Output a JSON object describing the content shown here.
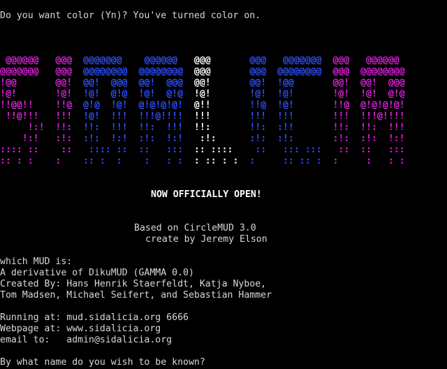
{
  "prompt_color": "Do you want color (Yn)? You've turned color on.",
  "banner": {
    "rows": [
      [
        {
          "t": " @@@@@@   ",
          "c": "#e020e0"
        },
        {
          "t": "@@@  ",
          "c": "#e020e0"
        },
        {
          "t": "@@@@@@@    ",
          "c": "#3050ff"
        },
        {
          "t": "@@@@@@   ",
          "c": "#3050ff"
        },
        {
          "t": "@@@       ",
          "c": "#ffffff"
        },
        {
          "t": "@@@   ",
          "c": "#3050ff"
        },
        {
          "t": "@@@@@@@  ",
          "c": "#3050ff"
        },
        {
          "t": "@@@   ",
          "c": "#e020e0"
        },
        {
          "t": "@@@@@@",
          "c": "#e020e0"
        }
      ],
      [
        {
          "t": "@@@@@@@   ",
          "c": "#e020e0"
        },
        {
          "t": "@@@  ",
          "c": "#e020e0"
        },
        {
          "t": "@@@@@@@@  ",
          "c": "#3050ff"
        },
        {
          "t": "@@@@@@@@  ",
          "c": "#3050ff"
        },
        {
          "t": "@@@       ",
          "c": "#ffffff"
        },
        {
          "t": "@@@  ",
          "c": "#3050ff"
        },
        {
          "t": "@@@@@@@@  ",
          "c": "#3050ff"
        },
        {
          "t": "@@@  ",
          "c": "#e020e0"
        },
        {
          "t": "@@@@@@@@",
          "c": "#e020e0"
        }
      ],
      [
        {
          "t": "!@@       ",
          "c": "#e020e0"
        },
        {
          "t": "@@!  ",
          "c": "#e020e0"
        },
        {
          "t": "@@!  @@@  ",
          "c": "#3050ff"
        },
        {
          "t": "@@!  @@@  ",
          "c": "#3050ff"
        },
        {
          "t": "@@!       ",
          "c": "#ffffff"
        },
        {
          "t": "@@!  ",
          "c": "#3050ff"
        },
        {
          "t": "!@@       ",
          "c": "#3050ff"
        },
        {
          "t": "@@!  ",
          "c": "#e020e0"
        },
        {
          "t": "@@!  @@@",
          "c": "#e020e0"
        }
      ],
      [
        {
          "t": "!@!       ",
          "c": "#e020e0"
        },
        {
          "t": "!@!  ",
          "c": "#e020e0"
        },
        {
          "t": "!@!  @!@  ",
          "c": "#3050ff"
        },
        {
          "t": "!@!  @!@  ",
          "c": "#3050ff"
        },
        {
          "t": "!@!       ",
          "c": "#ffffff"
        },
        {
          "t": "!@!  ",
          "c": "#3050ff"
        },
        {
          "t": "!@!       ",
          "c": "#3050ff"
        },
        {
          "t": "!@!  ",
          "c": "#e020e0"
        },
        {
          "t": "!@!  @!@",
          "c": "#e020e0"
        }
      ],
      [
        {
          "t": "!!@@!!    ",
          "c": "#e020e0"
        },
        {
          "t": "!!@  ",
          "c": "#e020e0"
        },
        {
          "t": "@!@  !@!  ",
          "c": "#3050ff"
        },
        {
          "t": "@!@!@!@!  ",
          "c": "#3050ff"
        },
        {
          "t": "@!!       ",
          "c": "#ffffff"
        },
        {
          "t": "!!@  ",
          "c": "#3050ff"
        },
        {
          "t": "!@!       ",
          "c": "#3050ff"
        },
        {
          "t": "!!@  ",
          "c": "#e020e0"
        },
        {
          "t": "@!@!@!@!",
          "c": "#e020e0"
        }
      ],
      [
        {
          "t": " !!@!!!   ",
          "c": "#e020e0"
        },
        {
          "t": "!!!  ",
          "c": "#e020e0"
        },
        {
          "t": "!@!  !!!  ",
          "c": "#3050ff"
        },
        {
          "t": "!!!@!!!!  ",
          "c": "#3050ff"
        },
        {
          "t": "!!!       ",
          "c": "#ffffff"
        },
        {
          "t": "!!!  ",
          "c": "#3050ff"
        },
        {
          "t": "!!!       ",
          "c": "#3050ff"
        },
        {
          "t": "!!!  ",
          "c": "#e020e0"
        },
        {
          "t": "!!!@!!!!",
          "c": "#e020e0"
        }
      ],
      [
        {
          "t": "     !:!  ",
          "c": "#e020e0"
        },
        {
          "t": "!!:  ",
          "c": "#e020e0"
        },
        {
          "t": "!!:  !!!  ",
          "c": "#3050ff"
        },
        {
          "t": "!!:  !!!  ",
          "c": "#3050ff"
        },
        {
          "t": "!!:       ",
          "c": "#ffffff"
        },
        {
          "t": "!!:  ",
          "c": "#3050ff"
        },
        {
          "t": ":!!       ",
          "c": "#3050ff"
        },
        {
          "t": "!!:  ",
          "c": "#e020e0"
        },
        {
          "t": "!!:  !!!",
          "c": "#e020e0"
        }
      ],
      [
        {
          "t": "    !:!   ",
          "c": "#e020e0"
        },
        {
          "t": ":!:  ",
          "c": "#e020e0"
        },
        {
          "t": ":!:  !:!  ",
          "c": "#3050ff"
        },
        {
          "t": ":!:  !:!  ",
          "c": "#3050ff"
        },
        {
          "t": " :!:      ",
          "c": "#ffffff"
        },
        {
          "t": ":!:  ",
          "c": "#3050ff"
        },
        {
          "t": ":!:       ",
          "c": "#3050ff"
        },
        {
          "t": ":!:  ",
          "c": "#e020e0"
        },
        {
          "t": ":!:  !:!",
          "c": "#e020e0"
        }
      ],
      [
        {
          "t": ":::: ::   ",
          "c": "#e020e0"
        },
        {
          "t": " ::  ",
          "c": "#e020e0"
        },
        {
          "t": " :::: ::  ",
          "c": "#3050ff"
        },
        {
          "t": "::   :::  ",
          "c": "#3050ff"
        },
        {
          "t": ":: ::::   ",
          "c": "#ffffff"
        },
        {
          "t": " ::  ",
          "c": "#3050ff"
        },
        {
          "t": " ::: :::  ",
          "c": "#3050ff"
        },
        {
          "t": " ::  ",
          "c": "#e020e0"
        },
        {
          "t": "::   :::",
          "c": "#e020e0"
        }
      ],
      [
        {
          "t": ":: : :    ",
          "c": "#e020e0"
        },
        {
          "t": ":    ",
          "c": "#e020e0"
        },
        {
          "t": ":: :  :   ",
          "c": "#3050ff"
        },
        {
          "t": " :   : :  ",
          "c": "#3050ff"
        },
        {
          "t": ": :: : :  ",
          "c": "#ffffff"
        },
        {
          "t": ":    ",
          "c": "#3050ff"
        },
        {
          "t": " :: :: :  ",
          "c": "#3050ff"
        },
        {
          "t": ":    ",
          "c": "#e020e0"
        },
        {
          "t": " :   : :",
          "c": "#e020e0"
        }
      ]
    ]
  },
  "announcement": "NOW OFFICIALLY OPEN!",
  "credits": {
    "based_on": "Based on CircleMUD 3.0",
    "created_by": "create by Jeremy Elson"
  },
  "info": {
    "which_mud": "which MUD is:",
    "derivative": "A derivative of DikuMUD (GAMMA 0.0)",
    "authors_1": "Created By: Hans Henrik Staerfeldt, Katja Nyboe,",
    "authors_2": "Tom Madsen, Michael Seifert, and Sebastian Hammer",
    "running_at": "Running at: mud.sidalicia.org 6666",
    "webpage_at": "Webpage at: www.sidalicia.org",
    "email_to": "email to:   admin@sidalicia.org"
  },
  "login_prompt": "By what name do you wish to be known?",
  "colors": {
    "magenta": "#e020e0",
    "blue": "#3050ff",
    "white": "#ffffff",
    "background": "#000000"
  }
}
